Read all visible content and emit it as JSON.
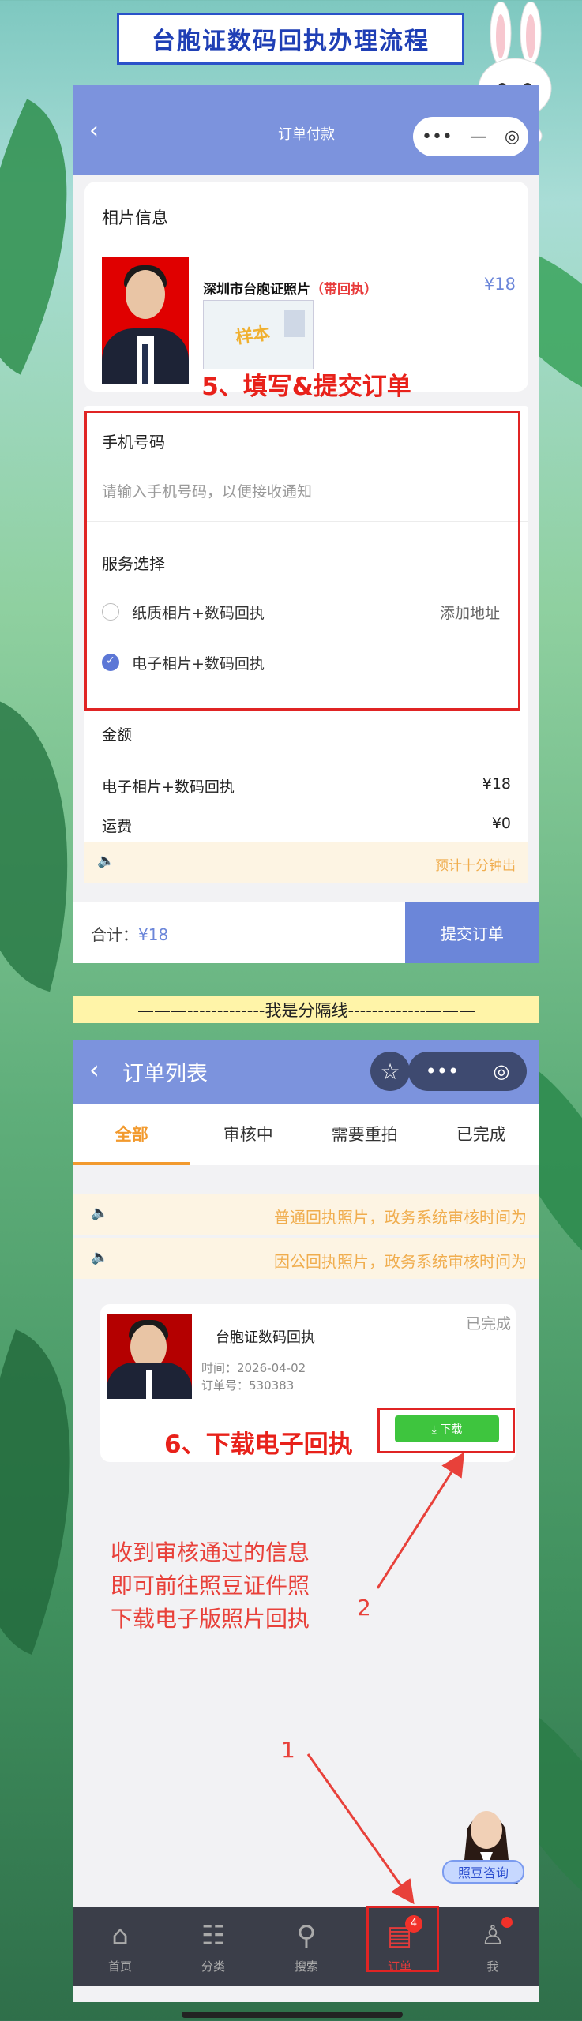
{
  "banner": {
    "title": "台胞证数码回执办理流程"
  },
  "screen1": {
    "nav_title": "订单付款",
    "capsule_more": "•••",
    "capsule_min": "—",
    "photo_section_title": "相片信息",
    "product_name": "深圳市台胞证照片",
    "product_tag": "（带回执）",
    "sample_stamp": "样本",
    "price": "¥18",
    "step5_caption": "5、填写&提交订单",
    "phone_label": "手机号码",
    "phone_placeholder": "请输入手机号码，以便接收通知",
    "service_label": "服务选择",
    "option1": "纸质相片+数码回执",
    "option1_action": "添加地址",
    "option2": "电子相片+数码回执",
    "amount_label": "金额",
    "amount_item": "电子相片+数码回执",
    "amount_item_value": "¥18",
    "shipping_label": "运费",
    "shipping_value": "¥0",
    "eta_notice": "预计十分钟出",
    "total_label": "合计：",
    "total_value": "¥18",
    "submit_label": "提交订单"
  },
  "separator": "———-------------我是分隔线-------------———",
  "screen2": {
    "nav_title": "订单列表",
    "tabs": [
      "全部",
      "审核中",
      "需要重拍",
      "已完成"
    ],
    "notice1": "普通回执照片，政务系统审核时间为",
    "notice2": "因公回执照片，政务系统审核时间为",
    "order_name": "台胞证数码回执",
    "order_status": "已完成",
    "order_time": "时间：2026-04-02",
    "order_no": "订单号：530383",
    "download_label": "⤓ 下载",
    "step6_caption": "6、下载电子回执",
    "instruction_lines": [
      "收到审核通过的信息",
      "即可前往照豆证件照",
      "下载电子版照片回执"
    ],
    "marker1": "1",
    "marker2": "2",
    "consult_label": "照豆咨询",
    "tabbar": [
      {
        "label": "首页",
        "icon": "home-icon"
      },
      {
        "label": "分类",
        "icon": "category-icon"
      },
      {
        "label": "搜索",
        "icon": "search-icon"
      },
      {
        "label": "订单",
        "icon": "order-icon",
        "badge": "4"
      },
      {
        "label": "我",
        "icon": "user-icon"
      }
    ]
  },
  "colors": {
    "accent": "#7c93dd",
    "highlight": "#e02424",
    "download": "#3ec53e",
    "warning": "#f0ad4e"
  }
}
